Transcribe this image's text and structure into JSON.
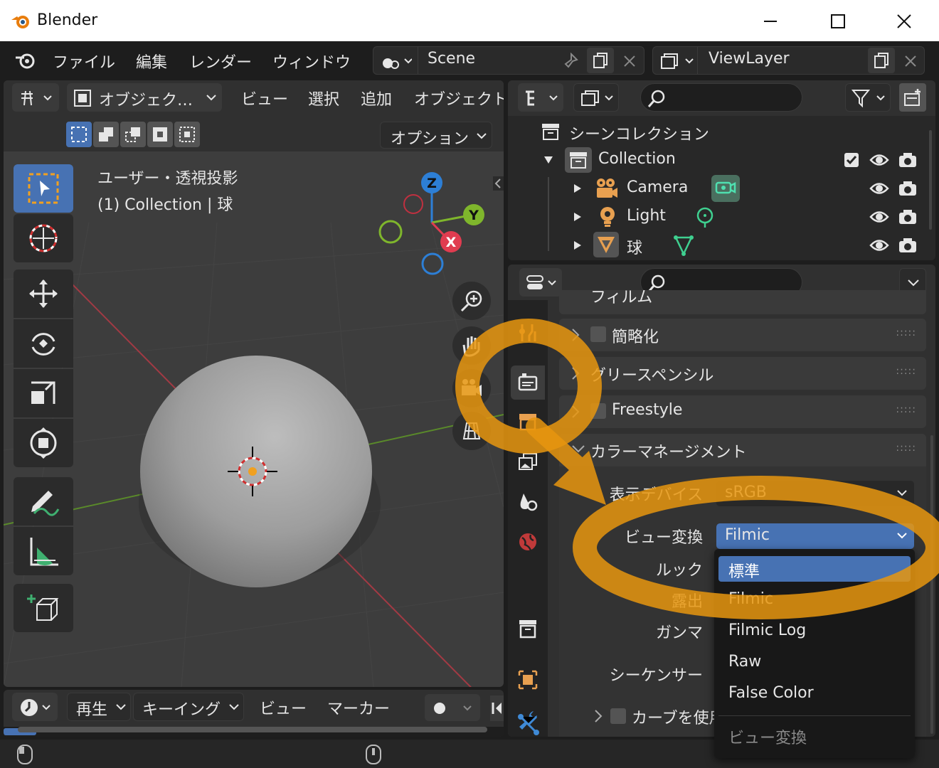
{
  "window": {
    "title": "Blender",
    "controls": [
      "minimize-icon",
      "maximize-icon",
      "close-icon"
    ]
  },
  "menubar": {
    "items": [
      "ファイル",
      "編集",
      "レンダー",
      "ウィンドウ"
    ],
    "scene": "Scene",
    "view_layer": "ViewLayer"
  },
  "viewport": {
    "header_menus": [
      "オブジェク…",
      "ビュー",
      "選択",
      "追加",
      "オブジェクト"
    ],
    "options_label": "オプション",
    "info_line1": "ユーザー・透視投影",
    "info_line2": "(1) Collection | 球",
    "gizmo_axes": {
      "x": "X",
      "y": "Y",
      "z": "Z"
    }
  },
  "timeline": {
    "menus": [
      "再生",
      "キーイング",
      "ビュー",
      "マーカー"
    ]
  },
  "outliner": {
    "root": "シーンコレクション",
    "collection": "Collection",
    "objects": [
      {
        "name": "Camera",
        "type_icon": "camera-data-icon"
      },
      {
        "name": "Light",
        "type_icon": "light-data-icon"
      },
      {
        "name": "球",
        "type_icon": "mesh-data-icon"
      }
    ]
  },
  "properties": {
    "panel_partial": "フィルム",
    "panels": [
      {
        "title": "簡略化",
        "checkbox": true
      },
      {
        "title": "グリースペンシル",
        "checkbox": false
      },
      {
        "title": "Freestyle",
        "checkbox": true
      },
      {
        "title": "カラーマネージメント",
        "checkbox": false,
        "expanded": true
      }
    ],
    "color_management": {
      "display_device_label": "表示デバイス",
      "display_device_value": "sRGB",
      "view_transform_label": "ビュー変換",
      "view_transform_value": "Filmic",
      "look_label": "ルック",
      "exposure_label": "露出",
      "gamma_label": "ガンマ",
      "sequencer_label": "シーケンサー",
      "curves_label": "カーブを使用"
    }
  },
  "dropdown": {
    "options": [
      "標準",
      "Filmic",
      "Filmic Log",
      "Raw",
      "False Color"
    ],
    "selected": "標準",
    "footer": "ビュー変換"
  },
  "colors": {
    "accent_blue": "#4772b3",
    "annotation_orange": "#e8960f",
    "axis_x": "#e03c50",
    "axis_y": "#7fb62c",
    "axis_z": "#2d7fd6"
  }
}
